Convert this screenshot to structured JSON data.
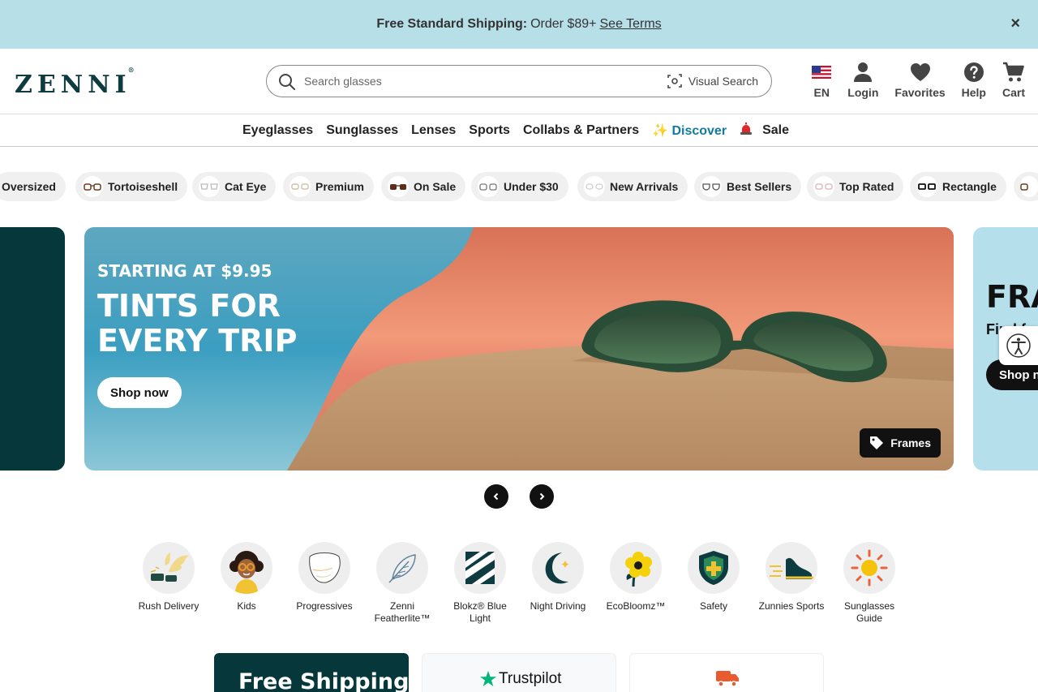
{
  "announcement": {
    "bold": "Free Standard Shipping:",
    "text": "Order $89+",
    "link": "See Terms",
    "close": "×"
  },
  "header": {
    "logo": "ZENNI",
    "logo_mark": "®",
    "search_placeholder": "Search glasses",
    "visual_search": "Visual Search",
    "icons": {
      "lang": "EN",
      "login": "Login",
      "favorites": "Favorites",
      "help": "Help",
      "cart": "Cart"
    }
  },
  "nav": [
    "Eyeglasses",
    "Sunglasses",
    "Lenses",
    "Sports",
    "Collabs & Partners",
    "✨ Discover",
    "Sale"
  ],
  "pills": [
    "Oversized",
    "Tortoiseshell",
    "Cat Eye",
    "Premium",
    "On Sale",
    "Under $30",
    "New Arrivals",
    "Best Sellers",
    "Top Rated",
    "Rectangle"
  ],
  "hero": {
    "kicker": "STARTING AT $9.95",
    "title_line1": "TINTS FOR",
    "title_line2": "EVERY TRIP",
    "cta": "Shop now",
    "tag": "Frames"
  },
  "next_slide": {
    "title": "FRA",
    "subtitle": "Find f",
    "cta": "Shop n"
  },
  "categories": [
    {
      "label": "Rush Delivery"
    },
    {
      "label": "Kids"
    },
    {
      "label": "Progressives"
    },
    {
      "label": "Zenni Featherlite™"
    },
    {
      "label": "Blokz® Blue Light"
    },
    {
      "label": "Night Driving"
    },
    {
      "label": "EcoBloomz™"
    },
    {
      "label": "Safety"
    },
    {
      "label": "Zunnies Sports"
    },
    {
      "label": "Sunglasses Guide"
    }
  ],
  "promos": {
    "p1": "Free Shipping",
    "p2": "Trustpilot"
  },
  "colors": {
    "announce_bg": "#b7dfe8",
    "brand_dark": "#06373a",
    "discover": "#137aa0",
    "accent_orange": "#e85a30"
  }
}
